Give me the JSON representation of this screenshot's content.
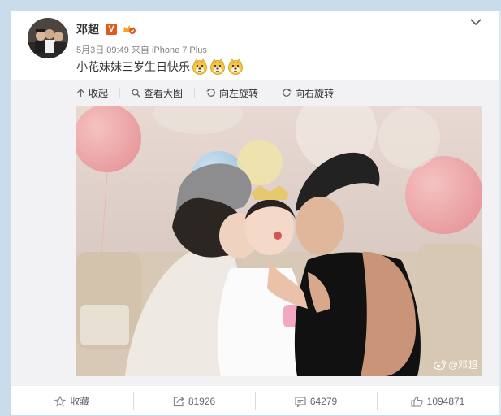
{
  "post": {
    "author": "邓超",
    "verified_badge": "V",
    "time": "5月3日 09:49",
    "via_prefix": "来自",
    "device": "iPhone 7 Plus",
    "text": "小花妹妹三岁生日快乐",
    "emoji": [
      "doge-icon",
      "doge-icon",
      "doge-icon"
    ]
  },
  "image_toolbar": {
    "collapse": "收起",
    "view_large": "查看大图",
    "rotate_left": "向左旋转",
    "rotate_right": "向右旋转"
  },
  "photo": {
    "watermark": "@邓超"
  },
  "actions": {
    "favorite": "收藏",
    "repost": "81926",
    "comment": "64279",
    "like": "1094871"
  },
  "colors": {
    "verified_orange": "#e05a1d",
    "vip_gold": "#f5a623",
    "background": "#c9dcec"
  }
}
